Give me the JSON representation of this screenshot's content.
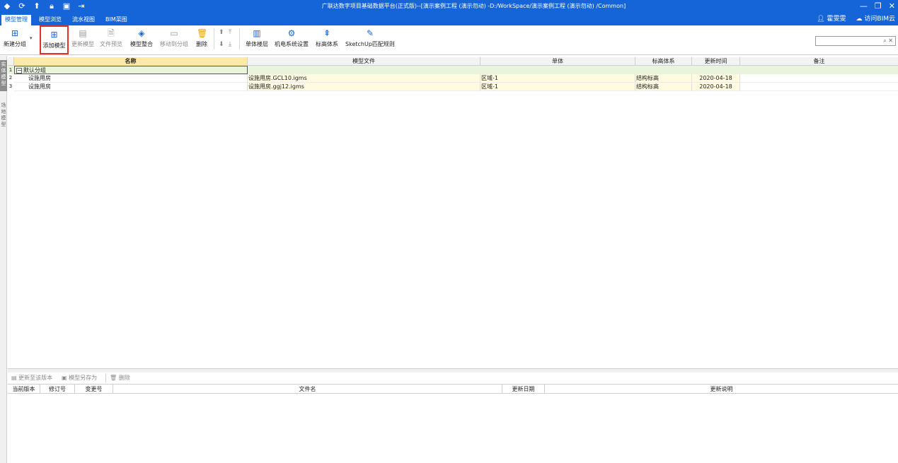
{
  "titlebar": {
    "title": "广联达数字项目基础数据平台(正式版)--[演示案例工程 (演示勿动) -D:/WorkSpace/演示案例工程 (演示勿动) /Common]",
    "minimize_glyph": "—",
    "restore_glyph": "❐",
    "close_glyph": "✕"
  },
  "menu": {
    "tabs": [
      "模型管理",
      "模型浏览",
      "流水视图",
      "BIM菜图"
    ],
    "user": "霍雯雯",
    "cloud": "访问BIM云"
  },
  "ribbon": {
    "new_group": "新建分组",
    "add_model": "添加模型",
    "update_model": "更新模型",
    "file_preview": "文件预览",
    "model_merge": "模型整合",
    "move_to_group": "移动到分组",
    "delete": "删除",
    "single_floor": "单体楼层",
    "mep_settings": "机电系统设置",
    "elevation_system": "标高体系",
    "sketchup_rules": "SketchUp匹配规则",
    "search_value": ""
  },
  "side_tabs": {
    "entity_model": "实体模型",
    "site_model": "场地模型"
  },
  "grid": {
    "columns": [
      "名称",
      "模型文件",
      "单体",
      "标高体系",
      "更新时间",
      "备注"
    ],
    "group": {
      "num": "1",
      "toggle": "−",
      "name": "默认分组"
    },
    "rows": [
      {
        "num": "2",
        "name": "设施用房",
        "file": "设施用房.GCL10.igms",
        "unit": "区域-1",
        "elevation": "结构标高",
        "updated": "2020-04-18",
        "note": ""
      },
      {
        "num": "3",
        "name": "设施用房",
        "file": "设施用房.ggj12.igms",
        "unit": "区域-1",
        "elevation": "结构标高",
        "updated": "2020-04-18",
        "note": ""
      }
    ]
  },
  "bottom": {
    "update_to_version": "更新至该版本",
    "save_model_as": "模型另存为",
    "delete": "删除",
    "columns": [
      "当前版本",
      "修订号",
      "变更号",
      "文件名",
      "更新日期",
      "更新说明"
    ]
  },
  "colors": {
    "brand": "#1565d8",
    "group_row": "#e9f4dc",
    "file_cells": "#fffbe0",
    "highlight_border": "#e0322b"
  }
}
